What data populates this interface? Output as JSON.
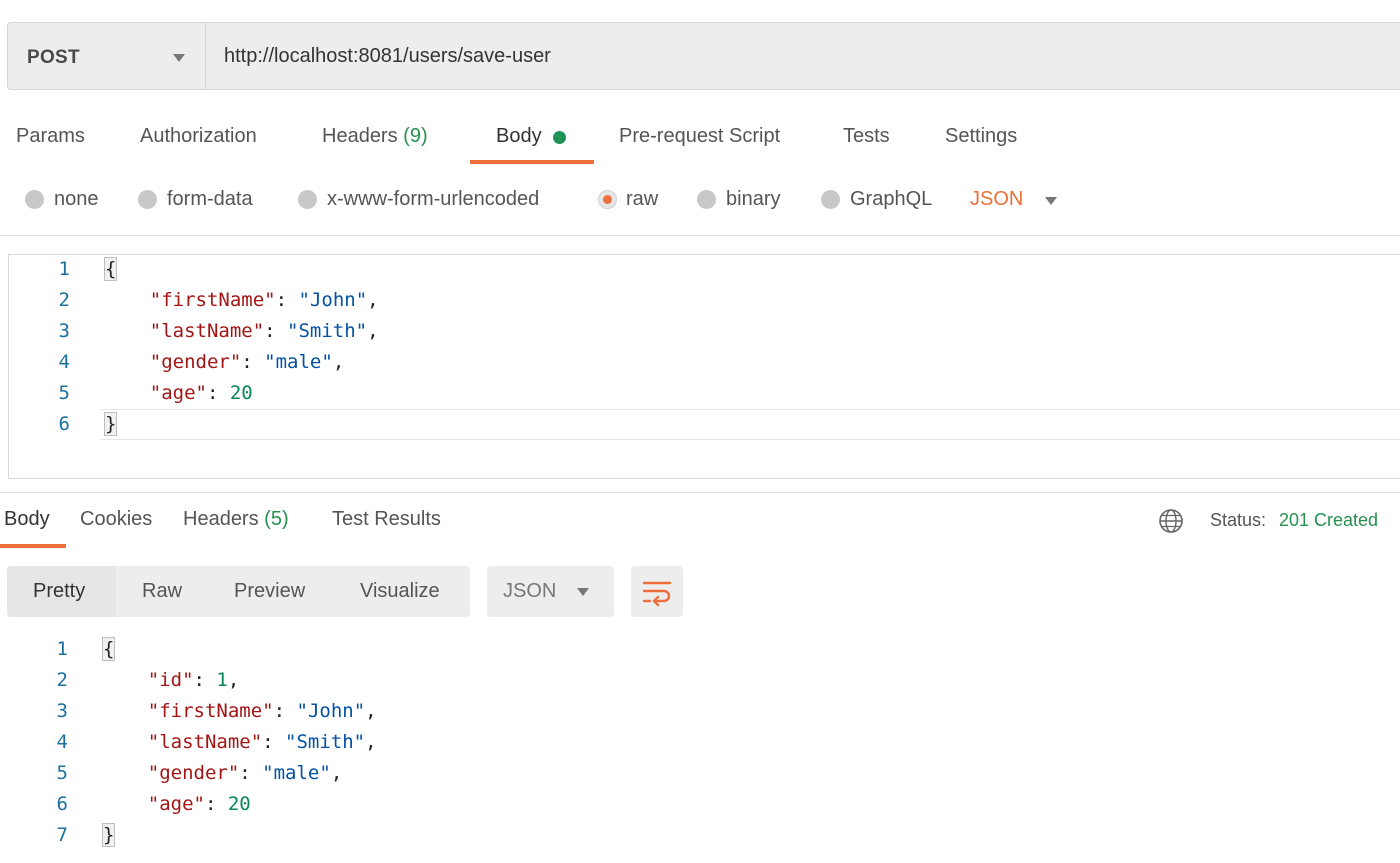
{
  "request": {
    "method": "POST",
    "url": "http://localhost:8081/users/save-user",
    "tabs": [
      {
        "label": "Params"
      },
      {
        "label": "Authorization"
      },
      {
        "label": "Headers",
        "count": "(9)"
      },
      {
        "label": "Body",
        "active": true
      },
      {
        "label": "Pre-request Script"
      },
      {
        "label": "Tests"
      },
      {
        "label": "Settings"
      }
    ],
    "body_types": [
      "none",
      "form-data",
      "x-www-form-urlencoded",
      "raw",
      "binary",
      "GraphQL"
    ],
    "selected_body_type": "raw",
    "format": "JSON",
    "line_numbers": [
      "1",
      "2",
      "3",
      "4",
      "5",
      "6"
    ]
  },
  "response": {
    "tabs": [
      {
        "label": "Body",
        "active": true
      },
      {
        "label": "Cookies"
      },
      {
        "label": "Headers",
        "count": "(5)"
      },
      {
        "label": "Test Results"
      }
    ],
    "status_label": "Status:",
    "status_value": "201 Created",
    "views": [
      "Pretty",
      "Raw",
      "Preview",
      "Visualize"
    ],
    "selected_view": "Pretty",
    "format": "JSON",
    "line_numbers": [
      "1",
      "2",
      "3",
      "4",
      "5",
      "6",
      "7"
    ]
  },
  "colors": {
    "accent": "#ef6f3c",
    "success": "#26904f",
    "json_key": "#a31515",
    "json_string": "#0451a5",
    "json_number": "#098658"
  },
  "icons": {
    "method_dropdown": "chevron-down-icon",
    "format_dropdown": "chevron-down-icon",
    "environment": "globe-icon",
    "wrap": "wrap-lines-icon"
  }
}
